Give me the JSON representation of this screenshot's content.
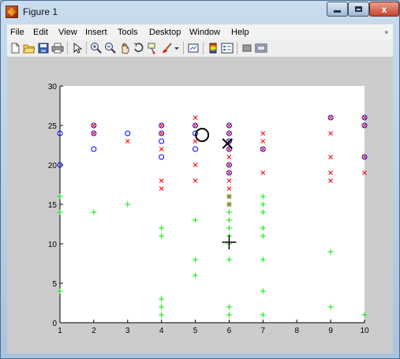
{
  "window": {
    "title": "Figure 1",
    "controls": {
      "minimize": "_",
      "maximize": "□",
      "close": "x"
    }
  },
  "menubar": {
    "items": [
      "File",
      "Edit",
      "View",
      "Insert",
      "Tools",
      "Desktop",
      "Window",
      "Help"
    ],
    "overflow_arrow": "»"
  },
  "toolbar": {
    "icons": [
      "new-figure-icon",
      "open-file-icon",
      "save-icon",
      "print-icon",
      "pointer-icon",
      "zoom-in-icon",
      "zoom-out-icon",
      "pan-hand-icon",
      "rotate-3d-icon",
      "data-cursor-icon",
      "brush-icon",
      "brush-dropdown-icon",
      "link-plot-icon",
      "colorbar-icon",
      "legend-icon",
      "hide-plot-tools-icon",
      "show-plot-tools-icon"
    ]
  },
  "colors": {
    "circle": "#0000ff",
    "cross": "#ff0000",
    "plus": "#00ee00",
    "highlight": "#000000",
    "axes_background": "#ffffff",
    "figure_background": "#cccccc"
  },
  "chart_data": {
    "type": "scatter",
    "title": "",
    "xlabel": "",
    "ylabel": "",
    "xlim": [
      1,
      10
    ],
    "ylim": [
      0,
      30
    ],
    "xticks": [
      1,
      2,
      3,
      4,
      5,
      6,
      7,
      8,
      9,
      10
    ],
    "yticks": [
      0,
      5,
      10,
      15,
      20,
      25,
      30
    ],
    "grid": false,
    "series": [
      {
        "marker": "o",
        "color": "#0000ff",
        "points": [
          [
            1,
            24
          ],
          [
            1,
            20
          ],
          [
            2,
            25
          ],
          [
            2,
            24
          ],
          [
            2,
            22
          ],
          [
            3,
            24
          ],
          [
            4,
            25
          ],
          [
            4,
            24
          ],
          [
            4,
            23
          ],
          [
            4,
            21
          ],
          [
            5,
            25
          ],
          [
            5,
            24
          ],
          [
            5,
            22
          ],
          [
            6,
            25
          ],
          [
            6,
            24
          ],
          [
            6,
            23
          ],
          [
            6,
            22
          ],
          [
            6,
            20
          ],
          [
            6,
            19
          ],
          [
            7,
            22
          ],
          [
            9,
            26
          ],
          [
            10,
            26
          ],
          [
            10,
            25
          ],
          [
            10,
            21
          ]
        ]
      },
      {
        "marker": "x",
        "color": "#ff0000",
        "points": [
          [
            2,
            25
          ],
          [
            2,
            24
          ],
          [
            3,
            23
          ],
          [
            4,
            25
          ],
          [
            4,
            24
          ],
          [
            4,
            22
          ],
          [
            4,
            18
          ],
          [
            4,
            17
          ],
          [
            5,
            26
          ],
          [
            5,
            25
          ],
          [
            5,
            23
          ],
          [
            5,
            20
          ],
          [
            5,
            18
          ],
          [
            6,
            25
          ],
          [
            6,
            24
          ],
          [
            6,
            23
          ],
          [
            6,
            22
          ],
          [
            6,
            21
          ],
          [
            6,
            20
          ],
          [
            6,
            19
          ],
          [
            6,
            18
          ],
          [
            6,
            17
          ],
          [
            6,
            16
          ],
          [
            6,
            15
          ],
          [
            7,
            24
          ],
          [
            7,
            23
          ],
          [
            7,
            22
          ],
          [
            7,
            19
          ],
          [
            9,
            26
          ],
          [
            9,
            24
          ],
          [
            9,
            21
          ],
          [
            9,
            19
          ],
          [
            9,
            18
          ],
          [
            10,
            26
          ],
          [
            10,
            25
          ],
          [
            10,
            21
          ],
          [
            10,
            19
          ]
        ]
      },
      {
        "marker": "+",
        "color": "#00ee00",
        "points": [
          [
            1,
            16
          ],
          [
            1,
            14
          ],
          [
            1,
            4
          ],
          [
            2,
            14
          ],
          [
            3,
            15
          ],
          [
            4,
            12
          ],
          [
            4,
            11
          ],
          [
            4,
            3
          ],
          [
            4,
            2
          ],
          [
            4,
            1
          ],
          [
            5,
            13
          ],
          [
            5,
            8
          ],
          [
            5,
            6
          ],
          [
            6,
            16
          ],
          [
            6,
            15
          ],
          [
            6,
            14
          ],
          [
            6,
            13
          ],
          [
            6,
            12
          ],
          [
            6,
            11
          ],
          [
            6,
            10
          ],
          [
            6,
            8
          ],
          [
            6,
            2
          ],
          [
            6,
            1
          ],
          [
            7,
            16
          ],
          [
            7,
            15
          ],
          [
            7,
            14
          ],
          [
            7,
            12
          ],
          [
            7,
            11
          ],
          [
            7,
            8
          ],
          [
            7,
            4
          ],
          [
            7,
            1
          ],
          [
            9,
            9
          ],
          [
            9,
            2
          ],
          [
            10,
            1
          ]
        ]
      },
      {
        "marker": "O",
        "color": "#000000",
        "points": [
          [
            5.2,
            23.8
          ]
        ]
      },
      {
        "marker": "X",
        "color": "#000000",
        "points": [
          [
            5.95,
            22.7
          ]
        ]
      },
      {
        "marker": "+",
        "color": "#000000",
        "points": [
          [
            6,
            10.2
          ]
        ]
      }
    ]
  }
}
